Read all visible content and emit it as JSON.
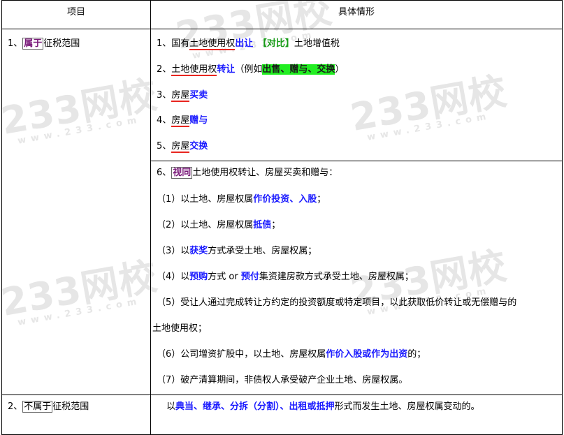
{
  "watermark": {
    "main": "233网校",
    "sub": "www.233.com"
  },
  "header": {
    "col1": "项目",
    "col2": "具体情形"
  },
  "row1": {
    "num": "1、",
    "tag": "属于",
    "label": "征税范围",
    "items": [
      {
        "prefix": "1、国有",
        "ul": "土地使用权",
        "blue": "出让",
        "gap": "　【对比】",
        "tail": "土地增值税"
      },
      {
        "prefix": "2、",
        "ul": "土地使用权",
        "blue": "转让",
        "pre2": "（例如",
        "hl": "出售、赠与、交换",
        "post": "）"
      },
      {
        "prefix": "3、",
        "ul": "房屋",
        "blue": "买卖"
      },
      {
        "prefix": "4、",
        "ul": "房屋",
        "blue": "赠与"
      },
      {
        "prefix": "5、",
        "ul": "房屋",
        "blue": "交换"
      }
    ],
    "deemed_title_prefix": "6、",
    "deemed_tag": "视同",
    "deemed_title_rest": "土地使用权转让、房屋买卖和赠与：",
    "deemed_items": [
      {
        "a": "（1）以土地、房屋权属",
        "b": "作价投资、入股",
        "c": "；"
      },
      {
        "a": "（2）以土地、房屋权属",
        "b": "抵债",
        "c": "；"
      },
      {
        "a": "（3）以",
        "b": "获奖",
        "c": "方式承受土地、房屋权属；"
      },
      {
        "a": "（4）以",
        "b": "预购",
        "c": "方式 or ",
        "d": "预付",
        "e": "集资建房款方式承受土地、房屋权属；"
      },
      {
        "a": "（5）受让人通过完成转让方约定的投资额度或特定项目，以此获取低价转让或无偿赠与的"
      },
      {
        "a": "土地使用权；"
      },
      {
        "a": "（6）公司增资扩股中，以土地、房屋权属",
        "b": "作价入股或作为出资",
        "c": "的；"
      },
      {
        "a": "（7）破产清算期间，非债权人承受破产企业土地、房屋权属。"
      }
    ]
  },
  "row2": {
    "num": "2、",
    "tag": "不属于",
    "label": "征税范围",
    "desc_a": "以",
    "desc_b": "典当、继承、分拆（分割）、出租或抵押",
    "desc_c": "形式而发生土地、房屋权属变动的。"
  }
}
